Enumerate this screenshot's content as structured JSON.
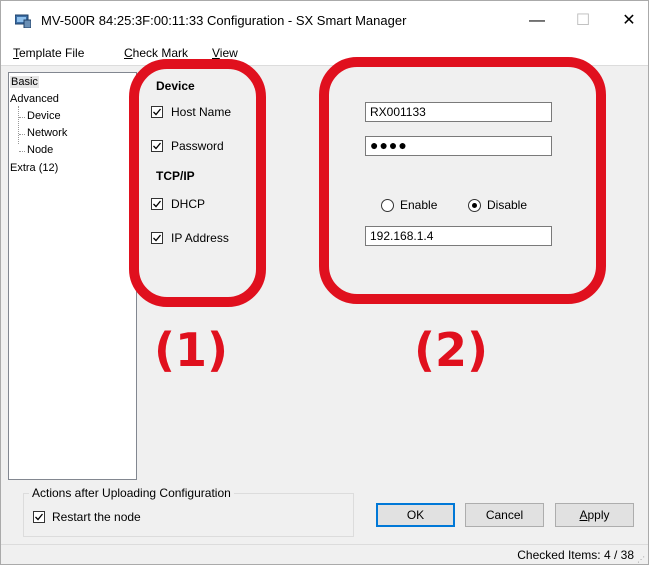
{
  "window": {
    "title": "MV-500R 84:25:3F:00:11:33 Configuration - SX Smart Manager",
    "controls": {
      "minimize": "—",
      "maximize": "☐",
      "close": "✕"
    }
  },
  "menu": {
    "items": [
      {
        "accel": "T",
        "rest": "emplate File"
      },
      {
        "accel": "C",
        "rest": "heck Mark"
      },
      {
        "accel": "V",
        "rest": "iew"
      }
    ]
  },
  "tree": {
    "items": [
      "Basic",
      "Advanced",
      "Device",
      "Network",
      "Node",
      "Extra (12)"
    ]
  },
  "settings": {
    "device_header": "Device",
    "tcpip_header": "TCP/IP",
    "host_name": {
      "label": "Host Name",
      "checked": true,
      "value": "RX001133"
    },
    "password": {
      "label": "Password",
      "checked": true,
      "value": "●●●●"
    },
    "dhcp": {
      "label": "DHCP",
      "checked": true,
      "enable_label": "Enable",
      "disable_label": "Disable",
      "selected": "Disable"
    },
    "ip_address": {
      "label": "IP Address",
      "checked": true,
      "value": "192.168.1.4"
    }
  },
  "annotations": {
    "label1": "(1)",
    "label2": "(2)",
    "color": "#e0101e"
  },
  "actions": {
    "group_title": "Actions after Uploading Configuration",
    "restart": {
      "label": "Restart the node",
      "checked": true
    }
  },
  "buttons": {
    "ok": "OK",
    "cancel": "Cancel",
    "apply_accel": "A",
    "apply_rest": "pply"
  },
  "status": {
    "text": "Checked Items: 4 / 38"
  }
}
